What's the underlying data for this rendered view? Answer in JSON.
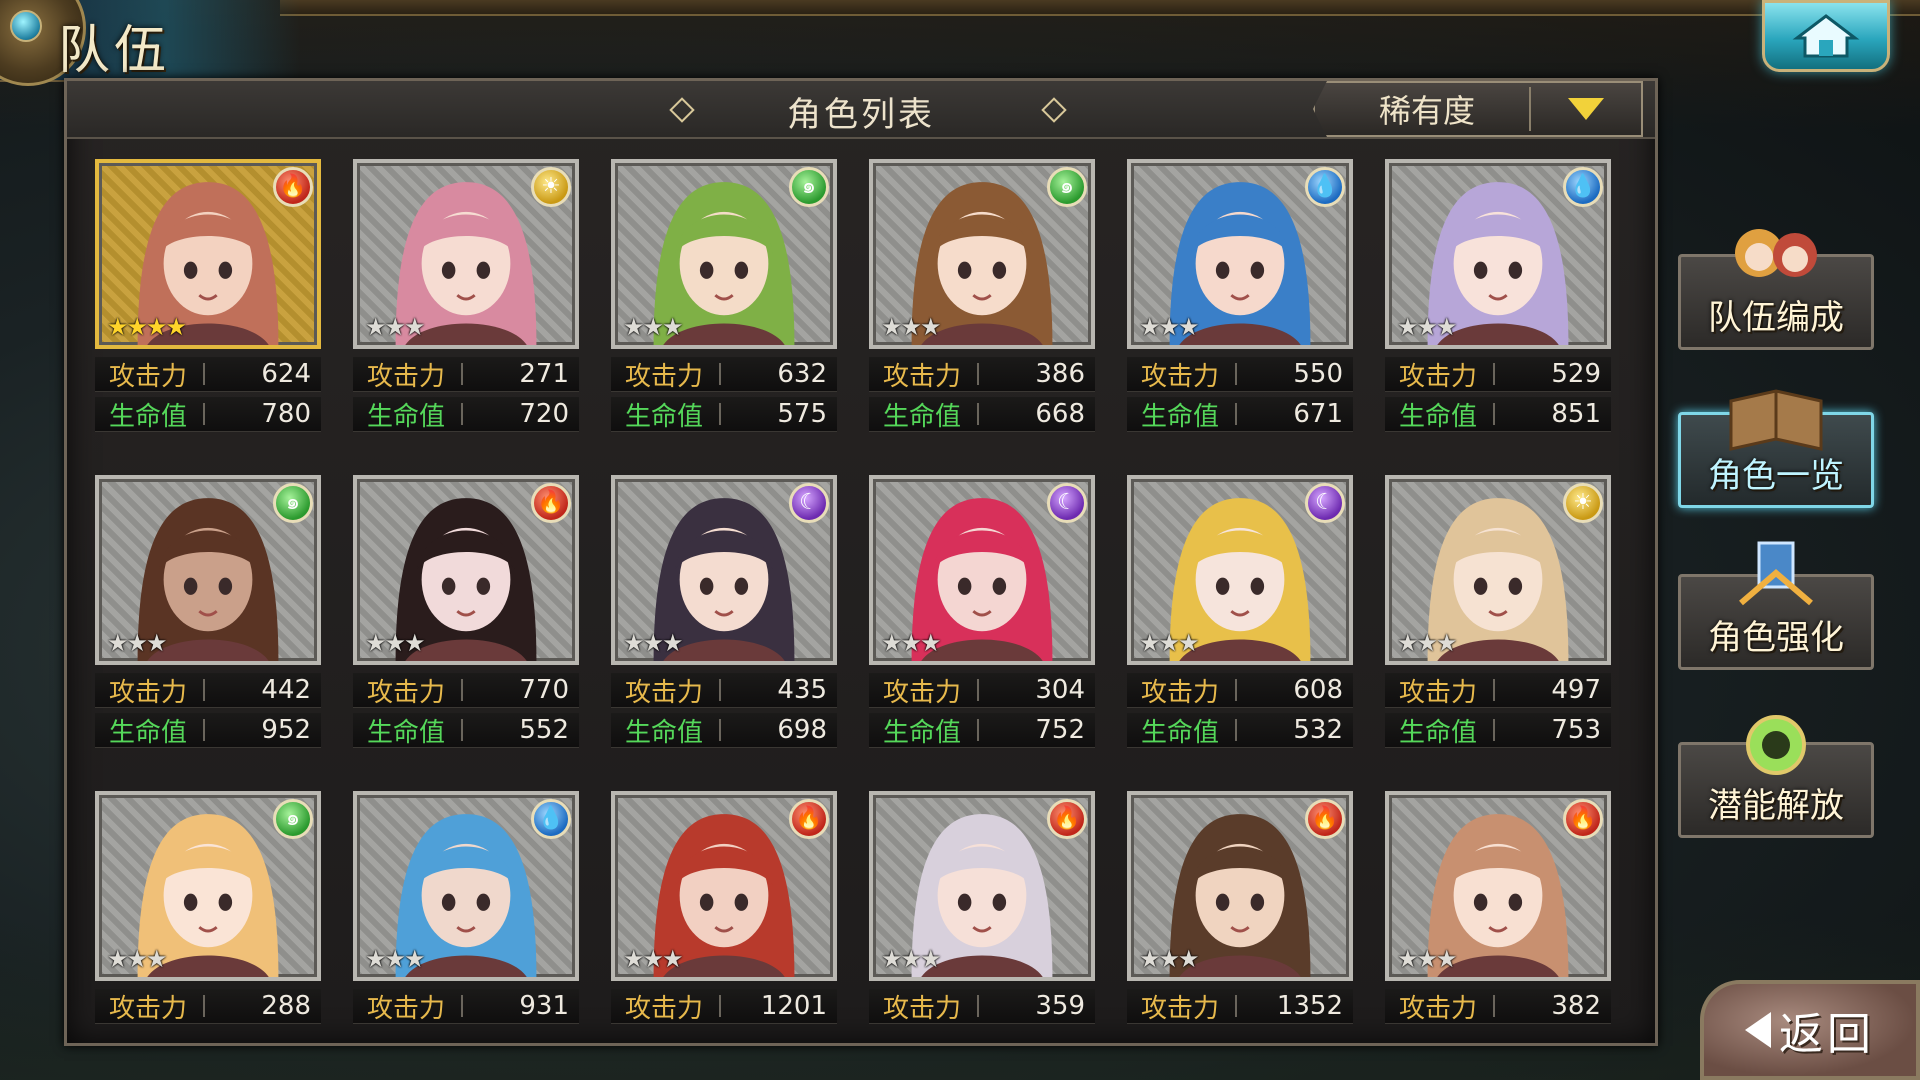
{
  "header": {
    "title": "队伍"
  },
  "panel": {
    "title": "角色列表"
  },
  "sort": {
    "label": "稀有度"
  },
  "stat_labels": {
    "attack": "攻击力",
    "hp": "生命值"
  },
  "characters": [
    {
      "element": "fire",
      "rarity": 4,
      "stars": "★★★★",
      "attack": "624",
      "hp": "780",
      "hair": "#c0705a",
      "skin": "#f3d2c0",
      "gold": true
    },
    {
      "element": "light",
      "rarity": 3,
      "stars": "★★★",
      "attack": "271",
      "hp": "720",
      "hair": "#d88aa0",
      "skin": "#f6dcd2",
      "gold": false
    },
    {
      "element": "wind",
      "rarity": 3,
      "stars": "★★★",
      "attack": "632",
      "hp": "575",
      "hair": "#7fb046",
      "skin": "#f4dcc8",
      "gold": false
    },
    {
      "element": "wind",
      "rarity": 3,
      "stars": "★★★",
      "attack": "386",
      "hp": "668",
      "hair": "#8b5a34",
      "skin": "#f6dccb",
      "gold": false
    },
    {
      "element": "water",
      "rarity": 3,
      "stars": "★★★",
      "attack": "550",
      "hp": "671",
      "hair": "#3a7fc8",
      "skin": "#f6d9cc",
      "gold": false
    },
    {
      "element": "water",
      "rarity": 3,
      "stars": "★★★",
      "attack": "529",
      "hp": "851",
      "hair": "#b7a6d8",
      "skin": "#f8e2da",
      "gold": false
    },
    {
      "element": "wind",
      "rarity": 3,
      "stars": "★★★",
      "attack": "442",
      "hp": "952",
      "hair": "#5a3424",
      "skin": "#caa08a",
      "gold": false
    },
    {
      "element": "fire",
      "rarity": 3,
      "stars": "★★★",
      "attack": "770",
      "hp": "552",
      "hair": "#2a1c1c",
      "skin": "#f1dada",
      "gold": false
    },
    {
      "element": "dark",
      "rarity": 3,
      "stars": "★★★",
      "attack": "435",
      "hp": "698",
      "hair": "#3a3040",
      "skin": "#f4dcd0",
      "gold": false
    },
    {
      "element": "dark",
      "rarity": 3,
      "stars": "★★★",
      "attack": "304",
      "hp": "752",
      "hair": "#d8305a",
      "skin": "#f4d6d2",
      "gold": false
    },
    {
      "element": "dark",
      "rarity": 3,
      "stars": "★★★",
      "attack": "608",
      "hp": "532",
      "hair": "#e8c04a",
      "skin": "#f6e4dc",
      "gold": false
    },
    {
      "element": "light",
      "rarity": 3,
      "stars": "★★★",
      "attack": "497",
      "hp": "753",
      "hair": "#e0c49a",
      "skin": "#f6e2d2",
      "gold": false
    },
    {
      "element": "wind",
      "rarity": 3,
      "stars": "★★★",
      "attack": "288",
      "hp": "",
      "hair": "#f0c078",
      "skin": "#fae4d6",
      "gold": false
    },
    {
      "element": "water",
      "rarity": 3,
      "stars": "★★★",
      "attack": "931",
      "hp": "",
      "hair": "#4fa0d8",
      "skin": "#f0d8cc",
      "gold": false
    },
    {
      "element": "fire",
      "rarity": 3,
      "stars": "★★★",
      "attack": "1201",
      "hp": "",
      "hair": "#b83a2c",
      "skin": "#f2d0c2",
      "gold": false
    },
    {
      "element": "fire",
      "rarity": 3,
      "stars": "★★★",
      "attack": "359",
      "hp": "",
      "hair": "#d8d0dc",
      "skin": "#f6e0d8",
      "gold": false
    },
    {
      "element": "fire",
      "rarity": 3,
      "stars": "★★★",
      "attack": "1352",
      "hp": "",
      "hair": "#5a3c2a",
      "skin": "#f0d4c0",
      "gold": false
    },
    {
      "element": "fire",
      "rarity": 3,
      "stars": "★★★",
      "attack": "382",
      "hp": "",
      "hair": "#c89070",
      "skin": "#f8e0d2",
      "gold": false
    }
  ],
  "element_icons": {
    "fire": "fire-icon",
    "light": "sun-icon",
    "wind": "wind-icon",
    "water": "water-drop-icon",
    "dark": "moon-icon"
  },
  "side_menu": [
    {
      "label": "队伍编成",
      "icon": "party-icon",
      "active": false
    },
    {
      "label": "角色一览",
      "icon": "book-icon",
      "active": true
    },
    {
      "label": "角色强化",
      "icon": "enhance-icon",
      "active": false
    },
    {
      "label": "潜能解放",
      "icon": "orb-icon",
      "active": false
    }
  ],
  "back": {
    "label": "返回"
  },
  "colors": {
    "accent": "#7fd7e8",
    "attack_label": "#e7b94c",
    "hp_label": "#55d85a",
    "star_gold": "#ffd42a"
  }
}
